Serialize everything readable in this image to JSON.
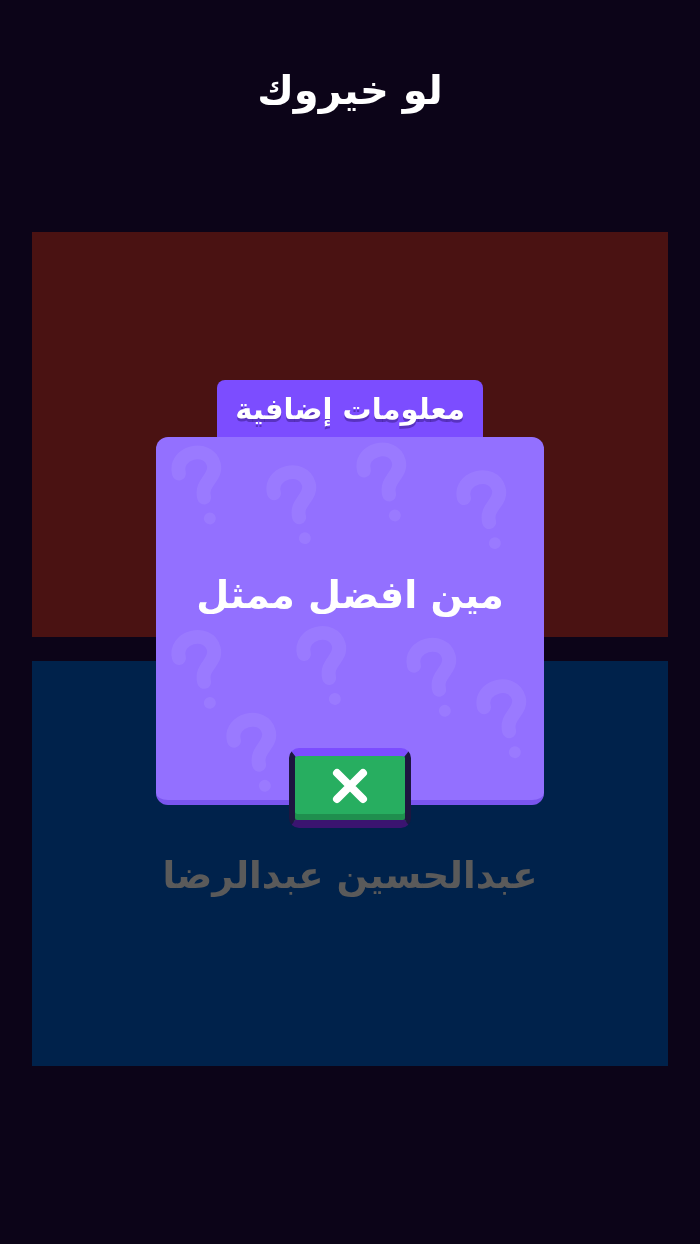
{
  "title": "لو خيروك",
  "options": [
    {
      "color": "#4a1212"
    },
    {
      "color": "#00224b",
      "text": "عبدالحسين عبدالرضا"
    }
  ],
  "modal": {
    "tab": "معلومات إضافية",
    "message": "مين افضل ممثل"
  }
}
